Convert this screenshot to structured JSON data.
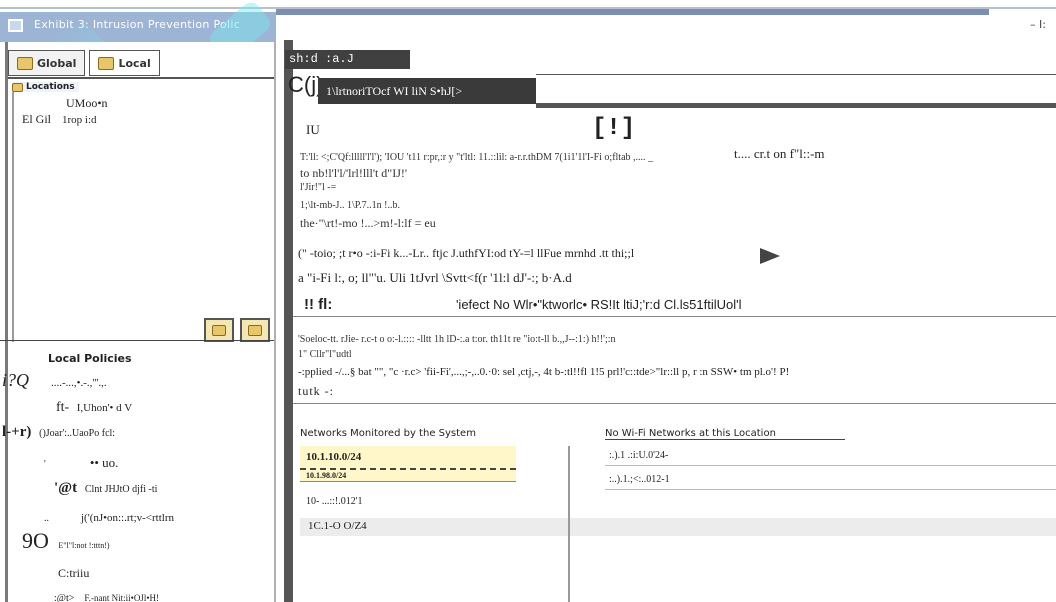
{
  "window": {
    "title": "Exhibit 3: Intrusion Prevention Polic",
    "top_right_text": "– I:"
  },
  "left_panel": {
    "tabs": [
      {
        "label": "Global",
        "icon": "folder-icon"
      },
      {
        "label": "Local",
        "icon": "folder-icon"
      }
    ],
    "locations_header": "Locations",
    "tree": {
      "line1": "UMoo•n",
      "line2_prefix": "El Gil",
      "line2_node": "1rop i:d"
    },
    "local_policies_title": "Local Policies",
    "policies": [
      {
        "mark": "i?Q",
        "text": "....-...,•.-.,'''.,."
      },
      {
        "mark": "ft-",
        "text": "I,Uhon'•  d V"
      },
      {
        "mark": "l-+r)",
        "text": "()Joar':..UaoPo fcl:"
      },
      {
        "mark": "'",
        "text": "•• uo."
      },
      {
        "mark": "'@t",
        "text": "Clnt JHJtO djfi -ti"
      },
      {
        "mark": "..",
        "text": "j('(nJ•on::.rt;v-<rttlrn"
      },
      {
        "mark": "9O",
        "text": "E\"l\"l:not  !:tttn!)"
      },
      {
        "mark": "",
        "text": "C:triiu"
      },
      {
        "mark": ":@t>",
        "text": "F.-nant  Nit:ii•OJl•H!"
      }
    ]
  },
  "right_panel": {
    "shortcut_label": "sh:d :a.J",
    "name_prefix": "C(j)",
    "name_value": "1\\lrtnoriTOcf WI liN S•hJ[>",
    "description_label": "IU",
    "description_button": "[!]",
    "description_lines": [
      "T:'ll: <;C'Qf:lllll'l'l'); 'IOU 't11 r:pr,:r y \"t'ltl: 11.::lil: a-r.r.thDM 7(1i1'1l'I-Fi o;fltab ,....  _",
      "to nb!l'l'l/'lrl!lll't d\"IJ!'",
      "l'Jir!\"l  -=",
      "1;\\lt-mb-J..  1\\P.7..1n  !..b.",
      "the·\"\\rt!-mo !...>m!-l:lf = eu"
    ],
    "description_side": "t.... cr.t on f\"l::-m",
    "row_a": "(\" -toio; ;t r•o -:i-Fi k...-Lr..  ftjc  J.uthfYI:od  tY-=l llFue mrnhd  .tt thi;;l",
    "row_b": "a \"i-Fi l:, o; ll\"'u. Uli 1tJvrl  \\Svtt<f(r '1l:l  dJ'-:; b·A.d",
    "row_c_label": "!! fl:",
    "row_c_text": "'iefect No  Wlr•\"ktworlc•   RS!It ltiJ;'r:d Cl.ls51ftilUol'l",
    "notes_line1": "'Soeloc-tt. rJie-  r.c-t o o:-l.::::  -lltt 1h lD-:.a t:or. th11t re  \"io:t-ll b.,,J--:1:) h!!';:n",
    "notes_line1b": "1\" Cllr\"l\"udtl",
    "notes_line2": "-:pplied -/...§  bat \"\",  \"c ·r.c> 'fii-Fi',...,;-,..0.·0: sel ,ctj,-, 4t b-:tl!!fl          1!5       prl!'c::tde>\"lr::ll p, r :n SSW• tm pl.o'! P!",
    "notes_line3": "tutk -:",
    "networks_monitored_title": "Networks Monitored by the System",
    "networks_monitored": [
      "10.1.10.0/24",
      "10.1.98.0/24",
      "10-  ...::!.012'1",
      "1C.1-O O/Z4"
    ],
    "no_wifi_title": "No Wi-Fi Networks at this Location",
    "no_wifi_networks": [
      ":.).1 .:i:U.0'24-",
      ":..).1.;<:..012-1"
    ]
  }
}
